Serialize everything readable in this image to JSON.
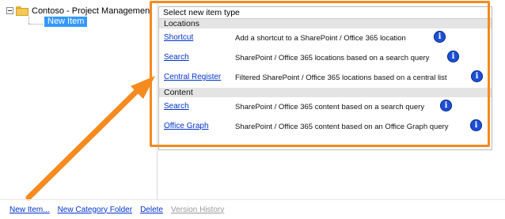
{
  "tree": {
    "root_label": "Contoso - Project Management",
    "selected_label": "New Item"
  },
  "panel": {
    "header": "Select new item type",
    "sections": [
      {
        "title": "Locations",
        "items": [
          {
            "link": "Shortcut",
            "description": "Add a shortcut to a SharePoint / Office 365 location",
            "icon": "info-icon"
          },
          {
            "link": "Search",
            "description": "SharePoint / Office 365 locations based on a search query",
            "icon": "info-icon"
          },
          {
            "link": "Central Register",
            "description": "Filtered SharePoint / Office 365 locations based on a central list",
            "icon": "info-icon"
          }
        ]
      },
      {
        "title": "Content",
        "items": [
          {
            "link": "Search",
            "description": "SharePoint / Office 365 content based on a search query",
            "icon": "info-icon"
          },
          {
            "link": "Office Graph",
            "description": "SharePoint / Office 365 content based on an Office Graph query",
            "icon": "info-icon"
          }
        ]
      }
    ]
  },
  "toolbar": {
    "new_item": "New Item...",
    "new_category_folder": "New Category Folder",
    "delete": "Delete",
    "version_history": "Version History"
  },
  "info_glyph": "i",
  "colors": {
    "callout_orange": "#f58a1f",
    "link_blue": "#0033cc",
    "selection_blue": "#3399ff",
    "info_blue": "#1c4fd6"
  }
}
